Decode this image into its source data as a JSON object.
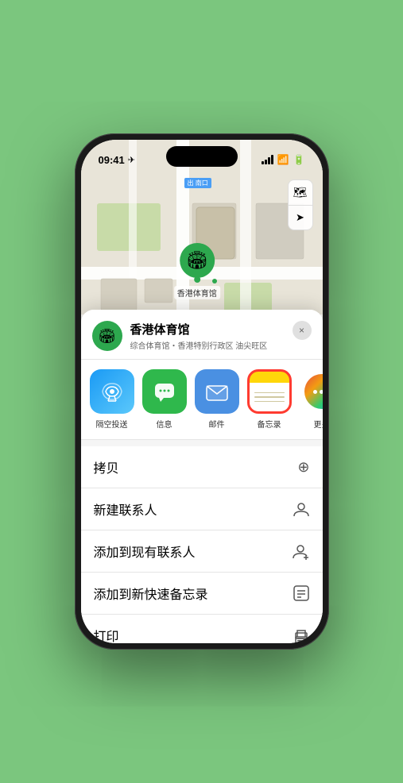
{
  "status_bar": {
    "time": "09:41",
    "location_icon": "▶"
  },
  "map": {
    "label": "南口",
    "label_prefix": "出"
  },
  "marker": {
    "name": "香港体育馆",
    "icon": "🏟"
  },
  "venue": {
    "name": "香港体育馆",
    "description": "综合体育馆・香港特别行政区 油尖旺区",
    "icon": "🏟"
  },
  "share_items": [
    {
      "id": "airdrop",
      "label": "隔空投送",
      "selected": false
    },
    {
      "id": "messages",
      "label": "信息",
      "selected": false
    },
    {
      "id": "mail",
      "label": "邮件",
      "selected": false
    },
    {
      "id": "notes",
      "label": "备忘录",
      "selected": true
    },
    {
      "id": "more",
      "label": "更多",
      "selected": false
    }
  ],
  "actions": [
    {
      "id": "copy",
      "label": "拷贝",
      "icon": "⊕"
    },
    {
      "id": "new-contact",
      "label": "新建联系人",
      "icon": "👤"
    },
    {
      "id": "add-existing",
      "label": "添加到现有联系人",
      "icon": "👤"
    },
    {
      "id": "quick-note",
      "label": "添加到新快速备忘录",
      "icon": "⊟"
    },
    {
      "id": "print",
      "label": "打印",
      "icon": "🖨"
    }
  ],
  "buttons": {
    "close_label": "×",
    "map_type_icon": "🗺",
    "location_icon": "➤"
  }
}
